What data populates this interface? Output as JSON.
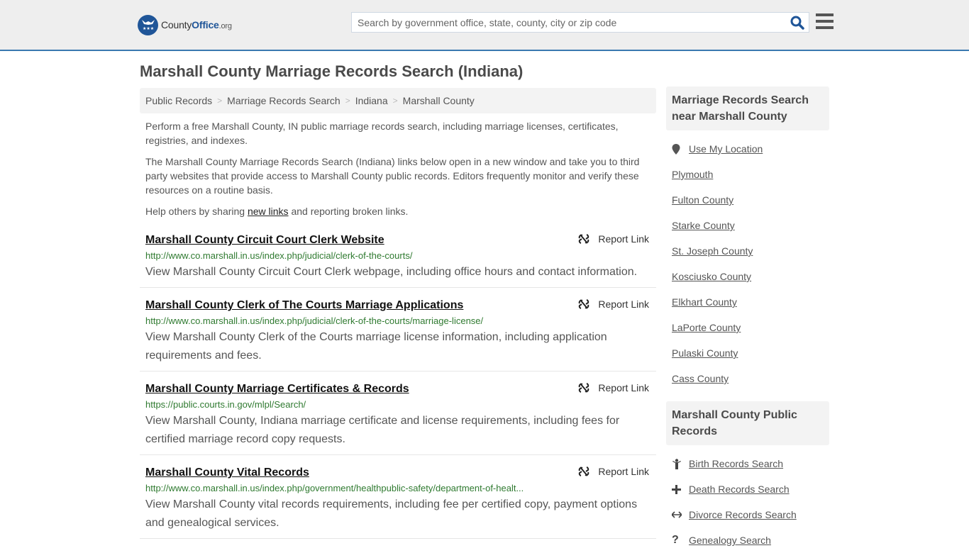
{
  "header": {
    "logo": {
      "part1": "County",
      "part2": "Office",
      "part3": ".org"
    },
    "search_placeholder": "Search by government office, state, county, city or zip code",
    "search_value": "",
    "accent_color": "#1f5598",
    "border_color": "#3a79b0"
  },
  "page": {
    "title": "Marshall County Marriage Records Search (Indiana)"
  },
  "breadcrumb": [
    {
      "label": "Public Records"
    },
    {
      "label": "Marriage Records Search"
    },
    {
      "label": "Indiana"
    },
    {
      "label": "Marshall County"
    }
  ],
  "intro": {
    "p1": "Perform a free Marshall County, IN public marriage records search, including marriage licenses, certificates, registries, and indexes.",
    "p2": "The Marshall County Marriage Records Search (Indiana) links below open in a new window and take you to third party websites that provide access to Marshall County public records. Editors frequently monitor and verify these resources on a routine basis.",
    "p3_before": "Help others by sharing ",
    "p3_link": "new links",
    "p3_after": " and reporting broken links."
  },
  "results": [
    {
      "title": "Marshall County Circuit Court Clerk Website",
      "url": "http://www.co.marshall.in.us/index.php/judicial/clerk-of-the-courts/",
      "description": "View Marshall County Circuit Court Clerk webpage, including office hours and contact information.",
      "report_label": "Report Link"
    },
    {
      "title": "Marshall County Clerk of The Courts Marriage Applications",
      "url": "http://www.co.marshall.in.us/index.php/judicial/clerk-of-the-courts/marriage-license/",
      "description": "View Marshall County Clerk of the Courts marriage license information, including application requirements and fees.",
      "report_label": "Report Link"
    },
    {
      "title": "Marshall County Marriage Certificates & Records",
      "url": "https://public.courts.in.gov/mlpl/Search/",
      "description": "View Marshall County, Indiana marriage certificate and license requirements, including fees for certified marriage record copy requests.",
      "report_label": "Report Link"
    },
    {
      "title": "Marshall County Vital Records",
      "url": "http://www.co.marshall.in.us/index.php/government/healthpublic-safety/department-of-healt...",
      "description": "View Marshall County vital records requirements, including fee per certified copy, payment options and genealogical services.",
      "report_label": "Report Link"
    }
  ],
  "sidebar": {
    "nearby": {
      "heading": "Marriage Records Search near Marshall County",
      "use_location": "Use My Location",
      "items": [
        "Plymouth",
        "Fulton County",
        "Starke County",
        "St. Joseph County",
        "Kosciusko County",
        "Elkhart County",
        "LaPorte County",
        "Pulaski County",
        "Cass County"
      ]
    },
    "public_records": {
      "heading": "Marshall County Public Records",
      "items": [
        {
          "label": "Birth Records Search",
          "icon": "child-icon"
        },
        {
          "label": "Death Records Search",
          "icon": "plus-icon"
        },
        {
          "label": "Divorce Records Search",
          "icon": "left-right-arrow-icon"
        },
        {
          "label": "Genealogy Search",
          "icon": "question-icon"
        }
      ]
    }
  }
}
